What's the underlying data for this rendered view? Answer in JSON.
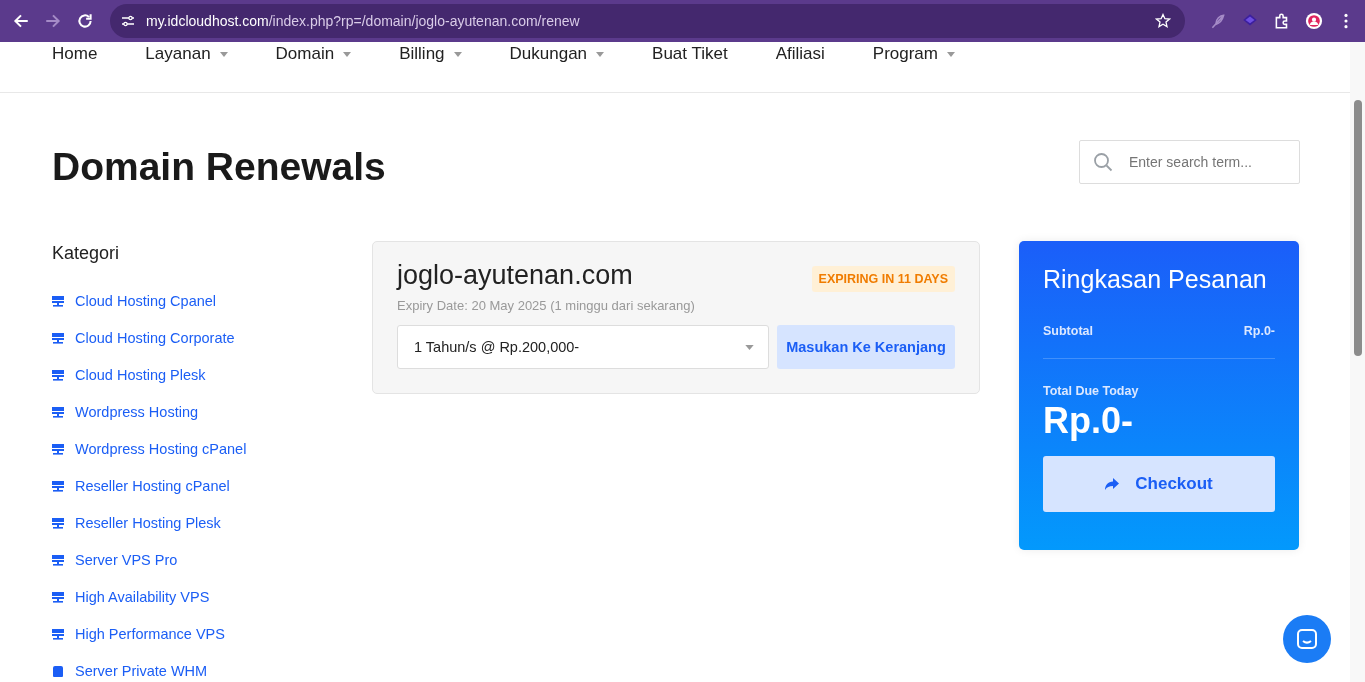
{
  "browser": {
    "url_host": "my.idcloudhost.com",
    "url_path": "/index.php?rp=/domain/joglo-ayutenan.com/renew"
  },
  "nav": [
    {
      "label": "Home",
      "dropdown": false
    },
    {
      "label": "Layanan",
      "dropdown": true
    },
    {
      "label": "Domain",
      "dropdown": true
    },
    {
      "label": "Billing",
      "dropdown": true
    },
    {
      "label": "Dukungan",
      "dropdown": true
    },
    {
      "label": "Buat Tiket",
      "dropdown": false
    },
    {
      "label": "Afiliasi",
      "dropdown": false
    },
    {
      "label": "Program",
      "dropdown": true
    }
  ],
  "page_title": "Domain Renewals",
  "search": {
    "placeholder": "Enter search term..."
  },
  "sidebar": {
    "title": "Kategori",
    "items": [
      {
        "label": "Cloud Hosting Cpanel",
        "kind": "server"
      },
      {
        "label": "Cloud Hosting Corporate",
        "kind": "server"
      },
      {
        "label": "Cloud Hosting Plesk",
        "kind": "server"
      },
      {
        "label": "Wordpress Hosting",
        "kind": "server"
      },
      {
        "label": "Wordpress Hosting cPanel",
        "kind": "server"
      },
      {
        "label": "Reseller Hosting cPanel",
        "kind": "server"
      },
      {
        "label": "Reseller Hosting Plesk",
        "kind": "server"
      },
      {
        "label": "Server VPS Pro",
        "kind": "server"
      },
      {
        "label": "High Availability VPS",
        "kind": "server"
      },
      {
        "label": "High Performance VPS",
        "kind": "server"
      },
      {
        "label": "Server Private WHM",
        "kind": "box"
      }
    ]
  },
  "domain": {
    "name": "joglo-ayutenan.com",
    "badge": "EXPIRING IN 11 DAYS",
    "expiry": "Expiry Date: 20 May 2025 (1 minggu dari sekarang)",
    "period": "1 Tahun/s @ Rp.200,000-",
    "add_button": "Masukan Ke Keranjang"
  },
  "summary": {
    "title": "Ringkasan Pesanan",
    "subtotal_label": "Subtotal",
    "subtotal_value": "Rp.0-",
    "total_label": "Total Due Today",
    "total_value": "Rp.0-",
    "checkout": "Checkout"
  }
}
